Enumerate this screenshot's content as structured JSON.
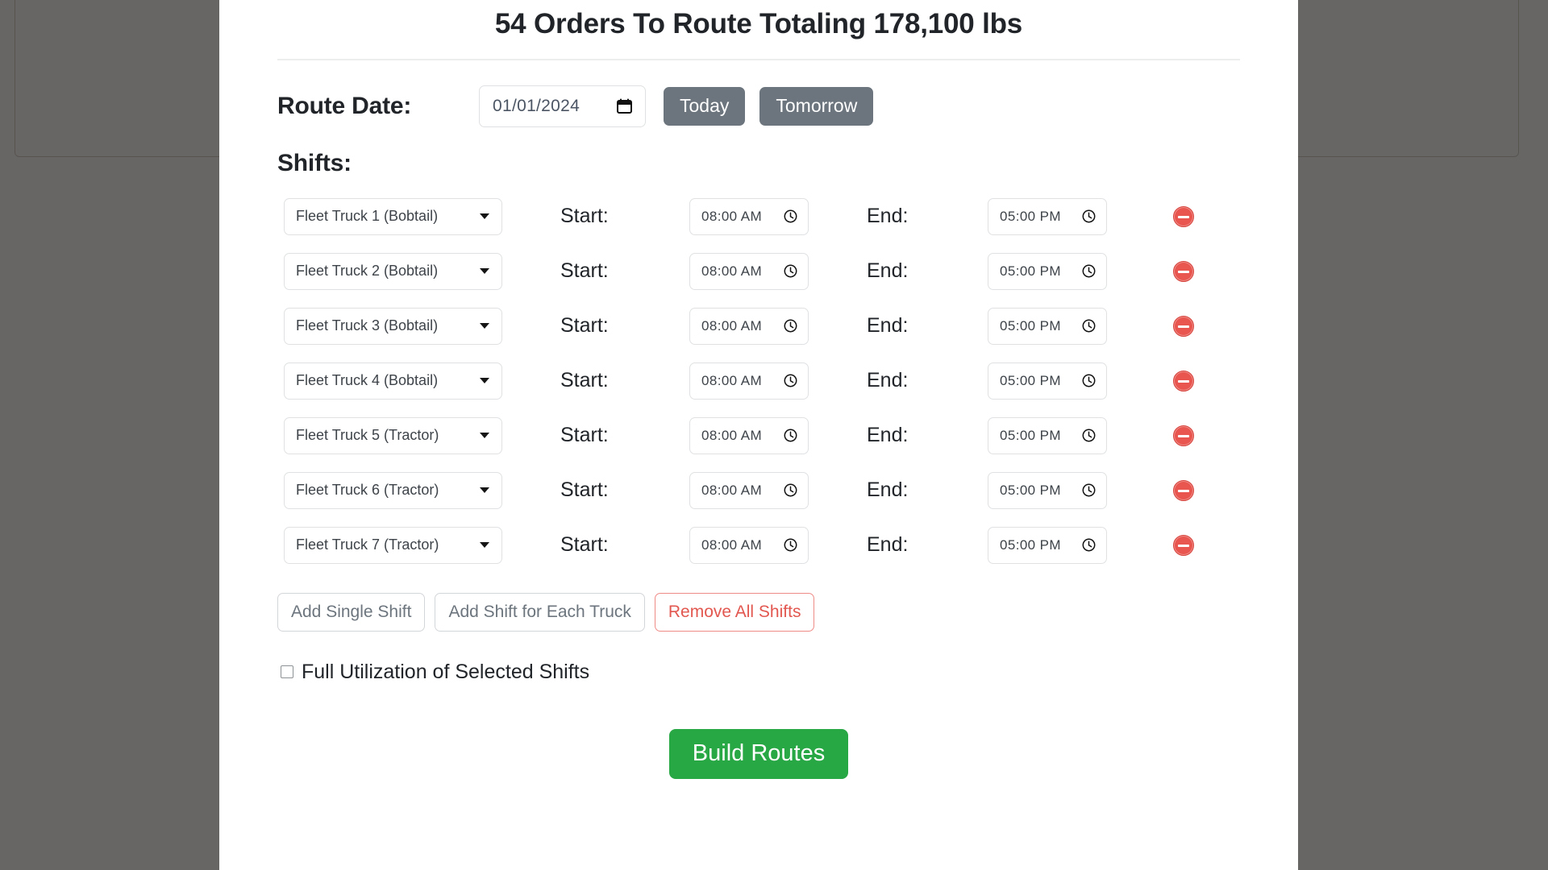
{
  "modal": {
    "title": "54 Orders To Route Totaling 178,100 lbs",
    "route_date": {
      "label": "Route Date:",
      "value": "01/01/2024",
      "picker_icon": "calendar-icon",
      "today_label": "Today",
      "tomorrow_label": "Tomorrow"
    },
    "shifts": {
      "label": "Shifts:",
      "start_label": "Start:",
      "end_label": "End:",
      "clock_icon": "clock-icon",
      "remove_icon": "minus-circle-icon",
      "rows": [
        {
          "truck": "Fleet Truck 1 (Bobtail)",
          "start": "08:00 AM",
          "end": "05:00 PM"
        },
        {
          "truck": "Fleet Truck 2 (Bobtail)",
          "start": "08:00 AM",
          "end": "05:00 PM"
        },
        {
          "truck": "Fleet Truck 3 (Bobtail)",
          "start": "08:00 AM",
          "end": "05:00 PM"
        },
        {
          "truck": "Fleet Truck 4 (Bobtail)",
          "start": "08:00 AM",
          "end": "05:00 PM"
        },
        {
          "truck": "Fleet Truck 5 (Tractor)",
          "start": "08:00 AM",
          "end": "05:00 PM"
        },
        {
          "truck": "Fleet Truck 6 (Tractor)",
          "start": "08:00 AM",
          "end": "05:00 PM"
        },
        {
          "truck": "Fleet Truck 7 (Tractor)",
          "start": "08:00 AM",
          "end": "05:00 PM"
        }
      ]
    },
    "actions": {
      "add_single_shift": "Add Single Shift",
      "add_shift_each_truck": "Add Shift for Each Truck",
      "remove_all_shifts": "Remove All Shifts"
    },
    "full_utilization": {
      "label": "Full Utilization of Selected Shifts",
      "checked": false
    },
    "build_routes_label": "Build Routes"
  },
  "colors": {
    "success": "#28a745",
    "secondary": "#6c757d",
    "danger": "#e2574f",
    "backdrop": "#57544f"
  }
}
